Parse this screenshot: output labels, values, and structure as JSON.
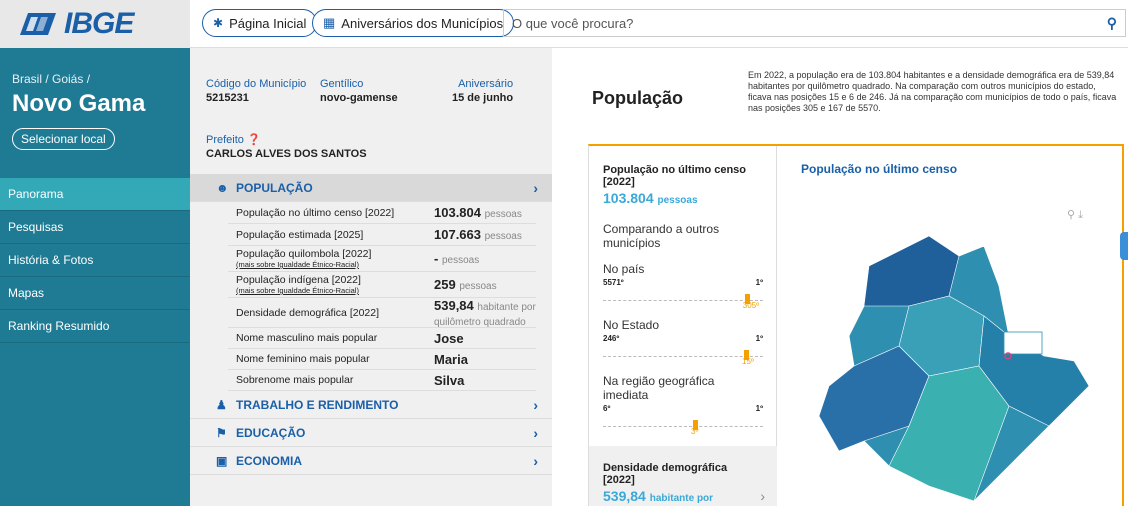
{
  "header": {
    "logo": "IBGE",
    "home_label": "Página Inicial",
    "anniversary_label": "Aniversários dos Municípios",
    "search_placeholder": "O que você procura?"
  },
  "sidebar": {
    "breadcrumb": "Brasil / Goiás /",
    "city": "Novo Gama",
    "select_label": "Selecionar local",
    "items": [
      {
        "label": "Panorama"
      },
      {
        "label": "Pesquisas"
      },
      {
        "label": "História & Fotos"
      },
      {
        "label": "Mapas"
      },
      {
        "label": "Ranking Resumido"
      }
    ]
  },
  "info": {
    "code_label": "Código do Município",
    "code_value": "5215231",
    "gentilic_label": "Gentílico",
    "gentilic_value": "novo-gamense",
    "anniversary_label": "Aniversário",
    "anniversary_value": "15 de junho",
    "mayor_label": "Prefeito",
    "mayor_value": "CARLOS ALVES DOS SANTOS"
  },
  "sections": {
    "populacao": "POPULAÇÃO",
    "trabalho": "TRABALHO E RENDIMENTO",
    "educacao": "EDUCAÇÃO",
    "economia": "ECONOMIA"
  },
  "rows": [
    {
      "label": "População no último censo [2022]",
      "sub": "",
      "value": "103.804",
      "unit": "pessoas"
    },
    {
      "label": "População estimada [2025]",
      "sub": "",
      "value": "107.663",
      "unit": "pessoas"
    },
    {
      "label": "População quilombola [2022]",
      "sub": "(mais sobre Igualdade Étnico-Racial)",
      "value": "-",
      "unit": "pessoas"
    },
    {
      "label": "População indígena [2022]",
      "sub": "(mais sobre Igualdade Étnico-Racial)",
      "value": "259",
      "unit": "pessoas"
    },
    {
      "label": "Densidade demográfica [2022]",
      "sub": "",
      "value": "539,84",
      "unit": "habitante por quilômetro quadrado"
    },
    {
      "label": "Nome masculino mais popular",
      "sub": "",
      "value": "Jose",
      "unit": ""
    },
    {
      "label": "Nome feminino mais popular",
      "sub": "",
      "value": "Maria",
      "unit": ""
    },
    {
      "label": "Sobrenome mais popular",
      "sub": "",
      "value": "Silva",
      "unit": ""
    }
  ],
  "populacao": {
    "title": "População",
    "description": "Em 2022, a população era de 103.804 habitantes e a densidade demográfica era de 539,84 habitantes por quilômetro quadrado. Na comparação com outros municípios do estado, ficava nas posições 15 e 6 de 246. Já na comparação com municípios de todo o país, ficava nas posições 305 e 167 de 5570.",
    "card_title": "População no último censo [2022]",
    "card_value": "103.804",
    "card_unit": "pessoas",
    "compare_label": "Comparando a outros municípios",
    "map_title": "População no último censo",
    "ranks": [
      {
        "title": "No país",
        "min": "5571º",
        "max": "1º",
        "pos": "305º",
        "fraction": 0.945
      },
      {
        "title": "No Estado",
        "min": "246º",
        "max": "1º",
        "pos": "15º",
        "fraction": 0.94
      },
      {
        "title": "Na região geográfica imediata",
        "min": "6º",
        "max": "1º",
        "pos": "3º",
        "fraction": 0.6
      }
    ],
    "dens_title": "Densidade demográfica [2022]",
    "dens_value": "539,84",
    "dens_unit": "habitante por"
  },
  "colors": {
    "accent": "#1a5fa8",
    "sidebar": "#1f7a94",
    "highlight": "#f5a000",
    "value": "#3aa8d8"
  }
}
